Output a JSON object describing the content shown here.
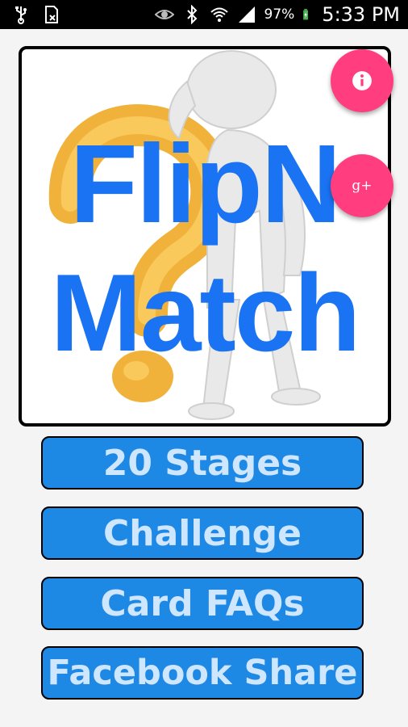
{
  "status_bar": {
    "battery_percent": "97%",
    "time": "5:33 PM",
    "icons": [
      "usb-icon",
      "sim-card-icon",
      "eye-icon",
      "bluetooth-icon",
      "wifi-icon",
      "signal-icon",
      "battery-charging-icon"
    ]
  },
  "hero": {
    "title_line1": "FlipN",
    "title_line2": "Match",
    "image_icon": "question-mark-figure-icon"
  },
  "fabs": {
    "info_icon": "info-icon",
    "gplus_label": "g+"
  },
  "menu": {
    "stages_label": "20 Stages",
    "challenge_label": "Challenge",
    "faqs_label": "Card FAQs",
    "share_label": "Facebook Share"
  },
  "colors": {
    "title_blue": "#1a73f2",
    "fab_pink": "#ff3d7f",
    "button_blue": "#1e88e5",
    "button_text": "#cfe6ff"
  }
}
